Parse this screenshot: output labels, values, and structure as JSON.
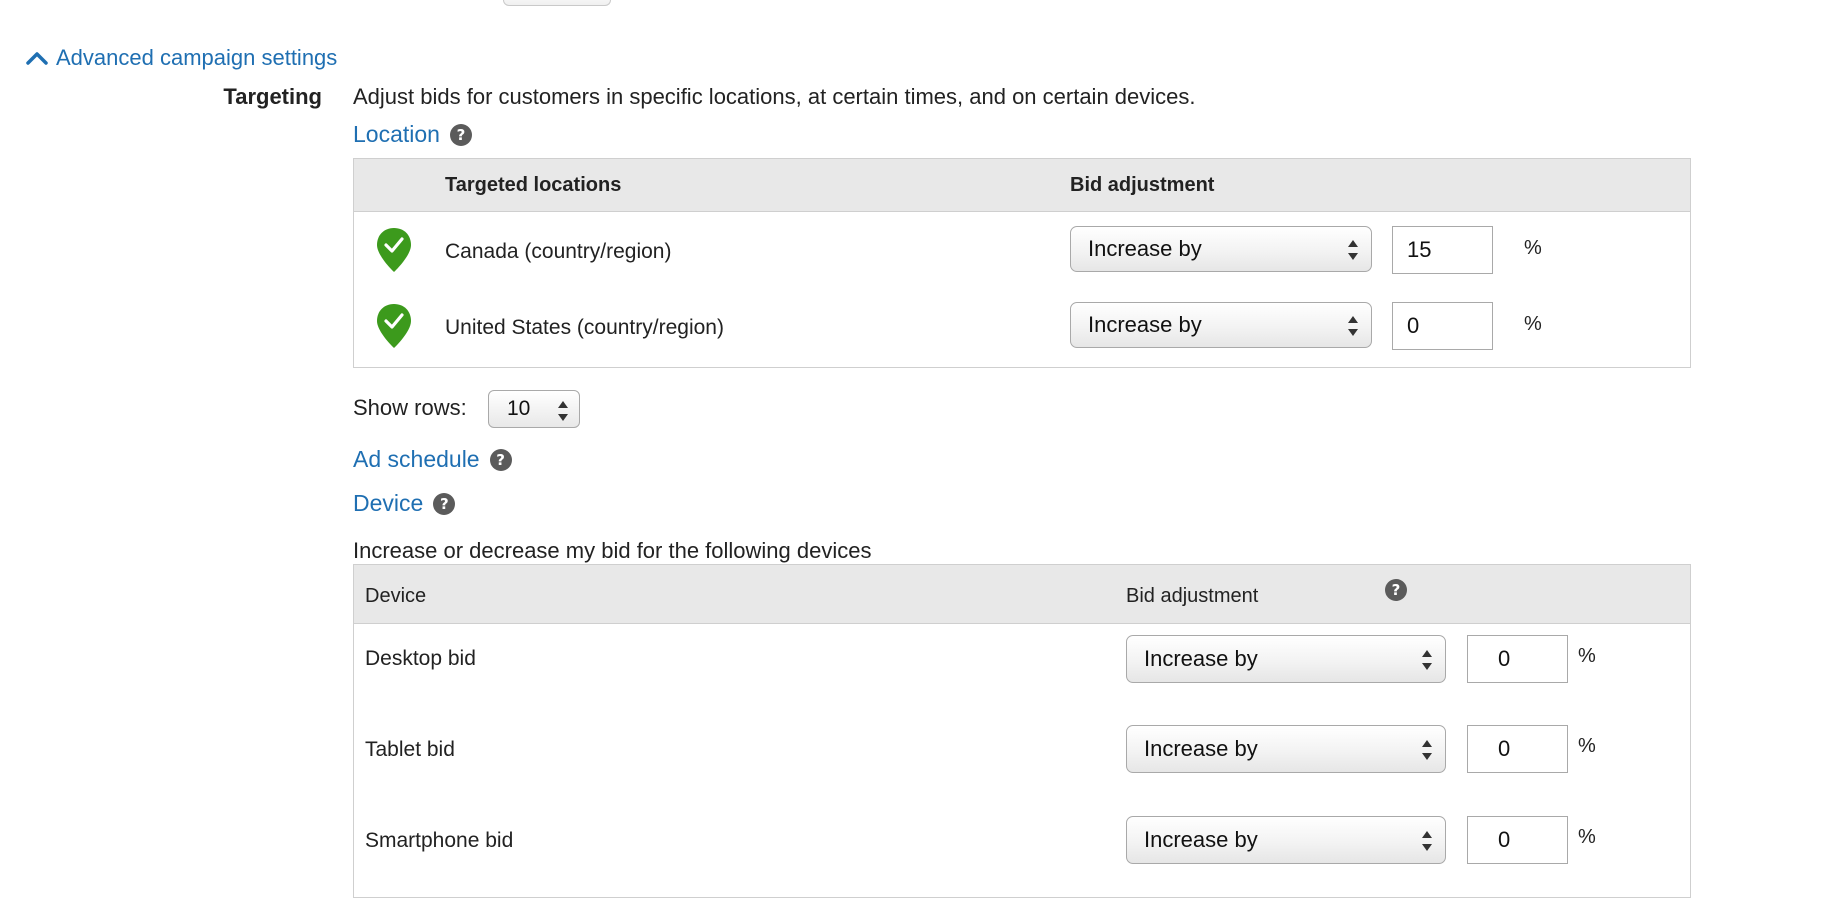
{
  "advanced": {
    "label": "Advanced campaign settings"
  },
  "targeting": {
    "label": "Targeting",
    "description": "Adjust bids for customers in specific locations, at certain times, and on certain devices."
  },
  "location": {
    "title": "Location",
    "help": "?",
    "col_locations": "Targeted locations",
    "col_bid": "Bid adjustment",
    "rows": [
      {
        "name": "Canada (country/region)",
        "mode": "Increase by",
        "value": "15",
        "unit": "%"
      },
      {
        "name": "United States (country/region)",
        "mode": "Increase by",
        "value": "0",
        "unit": "%"
      }
    ],
    "pin_color": "#3c9a1c"
  },
  "show_rows": {
    "label": "Show rows:",
    "value": "10"
  },
  "ad_schedule": {
    "title": "Ad schedule",
    "help": "?"
  },
  "device": {
    "title": "Device",
    "help": "?",
    "intro": "Increase or decrease my bid for the following devices",
    "col_device": "Device",
    "col_bid": "Bid adjustment",
    "rows": [
      {
        "name": "Desktop bid",
        "mode": "Increase by",
        "value": "0",
        "unit": "%"
      },
      {
        "name": "Tablet bid",
        "mode": "Increase by",
        "value": "0",
        "unit": "%"
      },
      {
        "name": "Smartphone bid",
        "mode": "Increase by",
        "value": "0",
        "unit": "%"
      }
    ]
  },
  "colors": {
    "link": "#1f6fb2",
    "header_bg": "#e8e8e8",
    "border": "#cfcfcf"
  }
}
